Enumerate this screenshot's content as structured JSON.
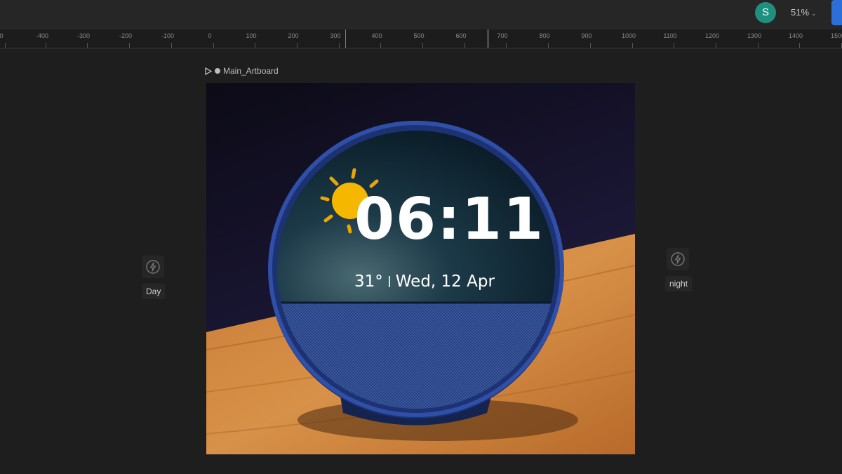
{
  "topbar": {
    "avatar_initial": "S",
    "zoom_level": "51%"
  },
  "ruler": {
    "labels": [
      "0",
      "-400",
      "-300",
      "-200",
      "-100",
      "0",
      "100",
      "200",
      "300",
      "400",
      "500",
      "600",
      "700",
      "800",
      "900",
      "1000",
      "1100",
      "1200",
      "1300",
      "1400",
      "1500"
    ]
  },
  "artboard": {
    "name": "Main_Artboard"
  },
  "device_screen": {
    "time": "06:11",
    "temperature": "31°",
    "date": "Wed, 12 Apr"
  },
  "states": {
    "left_label": "Day",
    "right_label": "night"
  },
  "colors": {
    "accent_blue": "#2d6fd8",
    "avatar_green": "#1f8f7e",
    "device_blue": "#1e3a8a",
    "sun_yellow": "#f5b700"
  }
}
